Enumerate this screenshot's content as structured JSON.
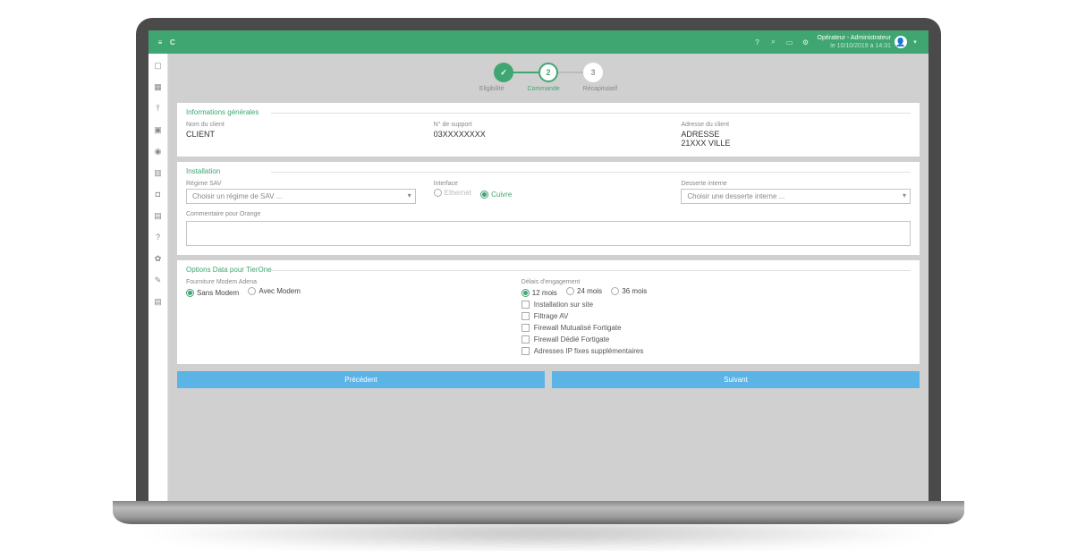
{
  "header": {
    "logo": "C",
    "user_name": "Opérateur - Administrateur",
    "user_sub": "le 10/10/2019 à 14:31"
  },
  "steps": {
    "s1": "Eligibilité",
    "s2": "Commande",
    "s3": "Récapitulatif",
    "num2": "2",
    "num3": "3",
    "check": "✓"
  },
  "info": {
    "legend": "Informations générales",
    "name_label": "Nom du client",
    "name_value": "CLIENT",
    "support_label": "N° de support",
    "support_value": "03XXXXXXXX",
    "addr_label": "Adresse du client",
    "addr_value1": "ADRESSE",
    "addr_value2": "21XXX VILLE"
  },
  "install": {
    "legend": "Installation",
    "sav_label": "Régime SAV",
    "sav_placeholder": "Choisir un régime de SAV ...",
    "iface_label": "Interface",
    "iface_opt1": "Ethernet",
    "iface_opt2": "Cuivre",
    "desserte_label": "Desserte interne",
    "desserte_placeholder": "Choisir une desserte interne ...",
    "comment_label": "Commentaire pour Orange"
  },
  "options": {
    "legend": "Options Data pour TierOne",
    "modem_label": "Fourniture Modem Adena",
    "modem_opt1": "Sans Modem",
    "modem_opt2": "Avec Modem",
    "engage_label": "Délais d'engagement",
    "engage_opt1": "12 mois",
    "engage_opt2": "24 mois",
    "engage_opt3": "36 mois",
    "chk1": "Installation sur site",
    "chk2": "Filtrage AV",
    "chk3": "Firewall Mutualisé Fortigate",
    "chk4": "Firewall Dédié Fortigate",
    "chk5": "Adresses IP fixes supplémentaires"
  },
  "buttons": {
    "prev": "Précédent",
    "next": "Suivant"
  }
}
